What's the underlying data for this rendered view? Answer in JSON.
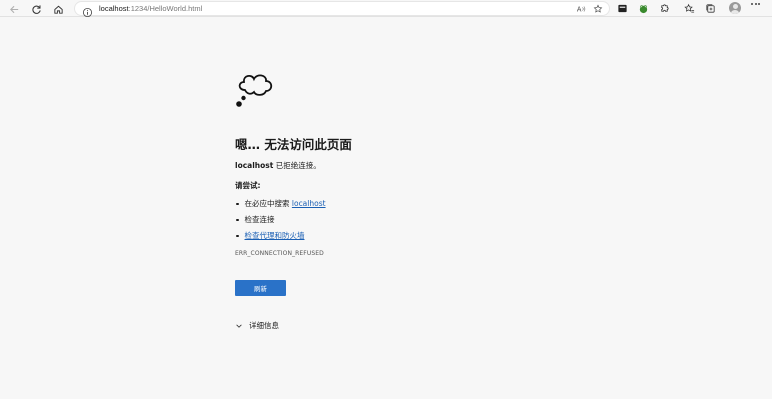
{
  "browser": {
    "url_host": "localhost",
    "url_path": ":1234/HelloWorld.html",
    "icons": {
      "back": "back-arrow-icon",
      "refresh": "refresh-icon",
      "home": "home-icon",
      "site_info": "info-icon",
      "read_aloud": "read-aloud-icon",
      "favorite_add": "add-favorite-icon",
      "extensions": [
        "extension-icon",
        "frog-extension-icon",
        "puzzle-icon"
      ],
      "favorites": "favorites-icon",
      "collections": "collections-icon",
      "profile": "avatar",
      "menu": "more-menu-icon"
    }
  },
  "page": {
    "title": "嗯… 无法访问此页面",
    "message_host": "localhost",
    "message_text": " 已拒绝连接。",
    "try_heading": "请尝试:",
    "suggestions": [
      {
        "prefix": "在必应中搜索 ",
        "link": "localhost"
      },
      {
        "prefix": "检查连接",
        "link": ""
      },
      {
        "prefix": "",
        "link": "检查代理和防火墙"
      }
    ],
    "error_code": "ERR_CONNECTION_REFUSED",
    "refresh_label": "刷新",
    "details_label": "详细信息"
  },
  "colors": {
    "background": "#f7f7f7",
    "link": "#1a5fb4",
    "button": "#2a72c8"
  }
}
